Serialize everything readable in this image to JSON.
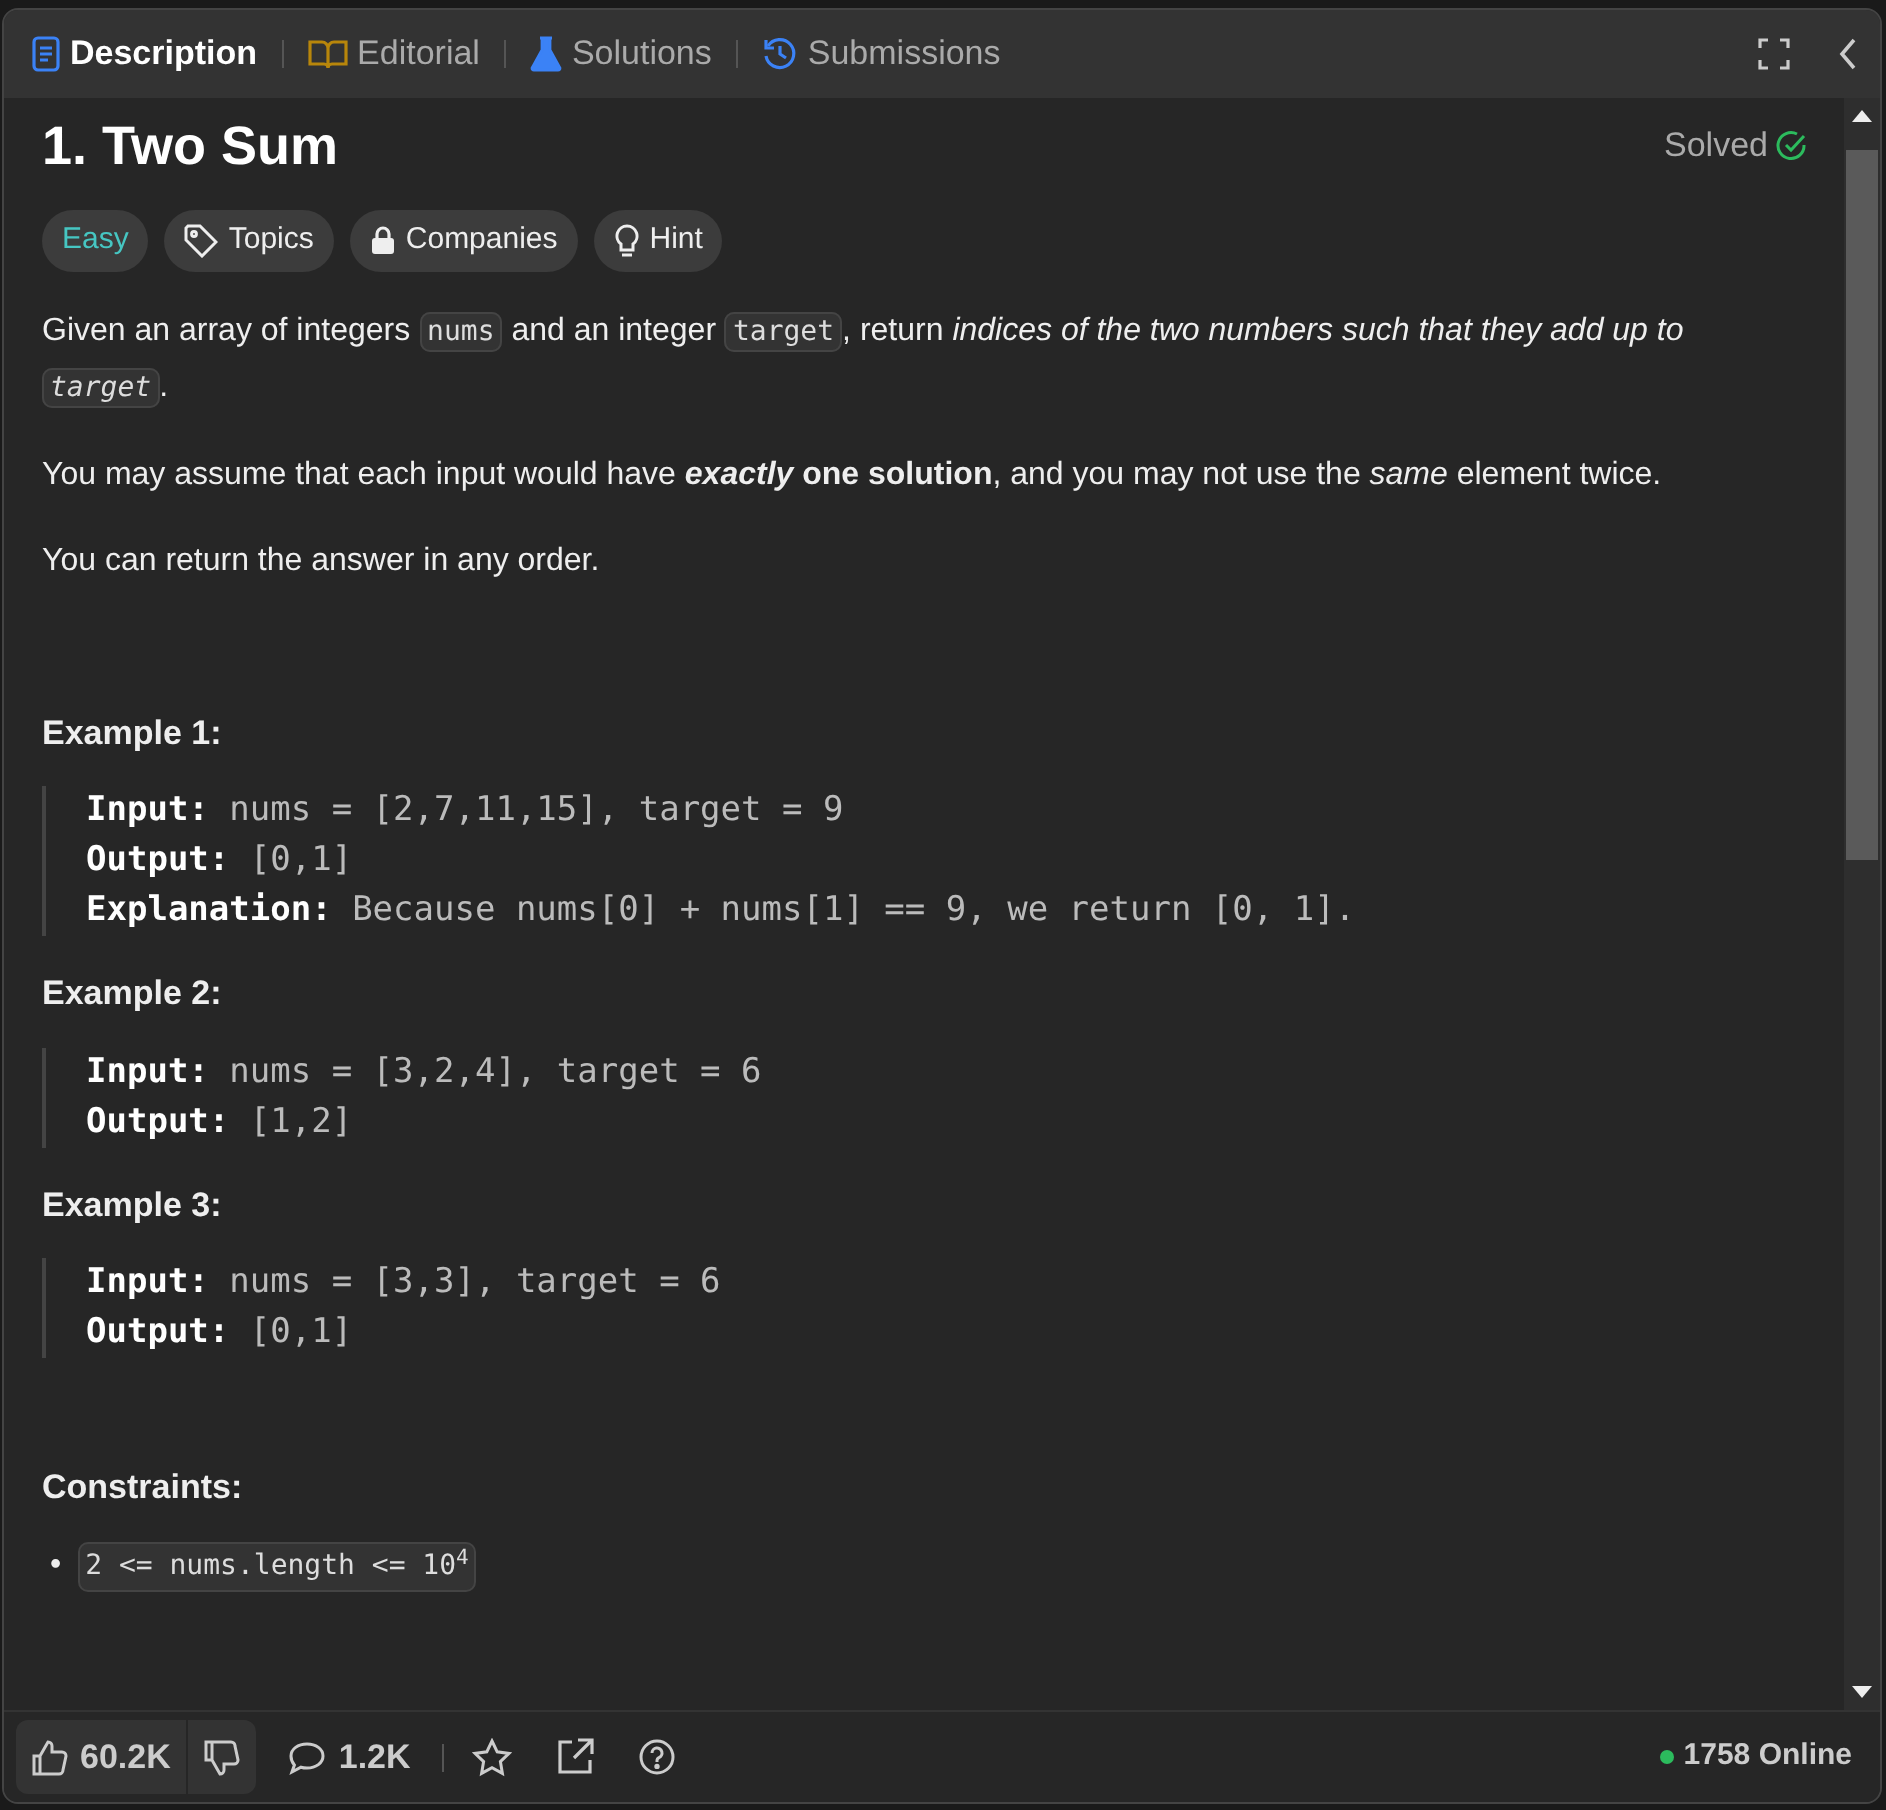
{
  "tabs": [
    {
      "label": "Description",
      "kind": "doc",
      "selected": true
    },
    {
      "label": "Editorial",
      "kind": "book",
      "selected": false
    },
    {
      "label": "Solutions",
      "kind": "flask",
      "selected": false
    },
    {
      "label": "Submissions",
      "kind": "history",
      "selected": false
    }
  ],
  "title": "1. Two Sum",
  "status": "Solved",
  "tags": [
    {
      "kind": "difficulty",
      "label": "Easy"
    },
    {
      "kind": "tag",
      "label": "Topics"
    },
    {
      "kind": "lock",
      "label": "Companies"
    },
    {
      "kind": "bulb",
      "label": "Hint"
    }
  ],
  "paragraphs": [
    [
      {
        "kind": "text",
        "text": "Given an array of integers "
      },
      {
        "kind": "code",
        "text": "nums"
      },
      {
        "kind": "text",
        "text": " and an integer "
      },
      {
        "kind": "code",
        "text": "target"
      },
      {
        "kind": "text",
        "text": ", return *indices of the two numbers such that they add up to* "
      },
      {
        "kind": "code_italic",
        "text": "target"
      },
      {
        "kind": "text",
        "text": "."
      }
    ],
    [
      {
        "kind": "text",
        "text": "You may assume that each input would have "
      },
      {
        "kind": "bold_italic",
        "text": "exactly"
      },
      {
        "kind": "text",
        "text": " **one solution**, and you may not use the *same* element twice."
      }
    ],
    [
      {
        "kind": "text",
        "text": "You can return the answer in any order."
      }
    ]
  ],
  "examples": [
    {
      "title": "Example 1:",
      "lines": [
        {
          "label": "Input:",
          "value": "nums = [2,7,11,15], target = 9"
        },
        {
          "label": "Output:",
          "value": "[0,1]"
        },
        {
          "label": "Explanation:",
          "value": "Because nums[0] + nums[1] == 9, we return [0, 1]."
        }
      ]
    },
    {
      "title": "Example 2:",
      "lines": [
        {
          "label": "Input:",
          "value": "nums = [3,2,4], target = 6"
        },
        {
          "label": "Output:",
          "value": "[1,2]"
        }
      ]
    },
    {
      "title": "Example 3:",
      "lines": [
        {
          "label": "Input:",
          "value": "nums = [3,3], target = 6"
        },
        {
          "label": "Output:",
          "value": "[0,1]"
        }
      ]
    }
  ],
  "constraints": {
    "title": "Constraints:",
    "marker": "•",
    "items": [
      "2 <= nums.length <= 10$^{4}$"
    ]
  },
  "footer": {
    "likes": "60.2K",
    "comments": "1.2K",
    "online": "1758 Online"
  }
}
